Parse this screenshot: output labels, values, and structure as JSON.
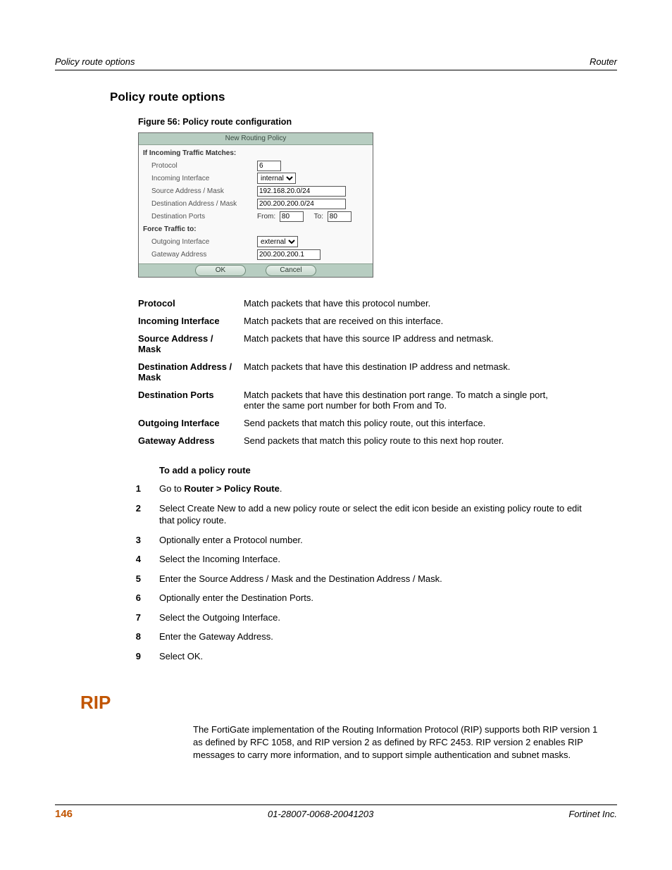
{
  "runningHead": {
    "left": "Policy route options",
    "right": "Router"
  },
  "sectionTitle": "Policy route options",
  "figureCaption": "Figure 56: Policy route configuration",
  "panel": {
    "title": "New Routing Policy",
    "group1": "If Incoming Traffic Matches:",
    "protocolLabel": "Protocol",
    "protocolValue": "6",
    "incIfaceLabel": "Incoming Interface",
    "incIfaceValue": "internal",
    "srcLabel": "Source Address / Mask",
    "srcValue": "192.168.20.0/24",
    "dstLabel": "Destination Address / Mask",
    "dstValue": "200.200.200.0/24",
    "dportsLabel": "Destination Ports",
    "fromLabel": "From:",
    "fromValue": "80",
    "toLabel": "To:",
    "toValue": "80",
    "group2": "Force Traffic to:",
    "outIfaceLabel": "Outgoing Interface",
    "outIfaceValue": "external",
    "gwLabel": "Gateway Address",
    "gwValue": "200.200.200.1",
    "okLabel": "OK",
    "cancelLabel": "Cancel"
  },
  "defs": {
    "r0t": "Protocol",
    "r0d": "Match packets that have this protocol number.",
    "r1t": "Incoming Interface",
    "r1d": "Match packets that are received on this interface.",
    "r2t": "Source Address / Mask",
    "r2d": "Match packets that have this source IP address and netmask.",
    "r3t": "Destination Address / Mask",
    "r3d": "Match packets that have this destination IP address and netmask.",
    "r4t": "Destination Ports",
    "r4d": "Match packets that have this destination port range. To match a single port, enter the same port number for both From and To.",
    "r5t": "Outgoing Interface",
    "r5d": "Send packets that match this policy route, out this interface.",
    "r6t": "Gateway Address",
    "r6d": "Send packets that match this policy route to this next hop router."
  },
  "stepsTitle": "To add a policy route",
  "steps": {
    "n1": "1",
    "t1a": "Go to ",
    "t1b": "Router > Policy Route",
    "t1c": ".",
    "n2": "2",
    "t2": "Select Create New to add a new policy route or select the edit icon beside an existing policy route to edit that policy route.",
    "n3": "3",
    "t3": "Optionally enter a Protocol number.",
    "n4": "4",
    "t4": "Select the Incoming Interface.",
    "n5": "5",
    "t5": "Enter the Source Address / Mask and the Destination Address / Mask.",
    "n6": "6",
    "t6": "Optionally enter the Destination Ports.",
    "n7": "7",
    "t7": "Select the Outgoing Interface.",
    "n8": "8",
    "t8": "Enter the Gateway Address.",
    "n9": "9",
    "t9": "Select OK."
  },
  "ripTitle": "RIP",
  "ripBody": "The FortiGate implementation of the Routing Information Protocol (RIP) supports both RIP version 1 as defined by RFC 1058, and RIP version 2 as defined by RFC 2453. RIP version 2 enables RIP messages to carry more information, and to support simple authentication and subnet masks.",
  "footer": {
    "pageNum": "146",
    "docId": "01-28007-0068-20041203",
    "company": "Fortinet Inc."
  }
}
